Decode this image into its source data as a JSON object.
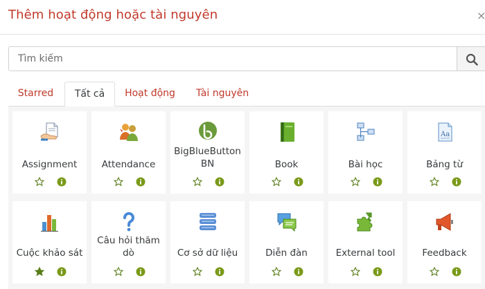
{
  "dialog": {
    "title": "Thêm hoạt động hoặc tài nguyên",
    "close_symbol": "×"
  },
  "search": {
    "placeholder": "Tìm kiếm"
  },
  "tabs": [
    {
      "label": "Starred",
      "active": false
    },
    {
      "label": "Tất cả",
      "active": true
    },
    {
      "label": "Hoạt động",
      "active": false
    },
    {
      "label": "Tài nguyên",
      "active": false
    }
  ],
  "modules": [
    {
      "label": "Assignment",
      "icon": "assignment-icon",
      "starred": false
    },
    {
      "label": "Attendance",
      "icon": "attendance-icon",
      "starred": false
    },
    {
      "label": "BigBlueButton BN",
      "icon": "bigbluebutton-icon",
      "starred": false
    },
    {
      "label": "Book",
      "icon": "book-icon",
      "starred": false
    },
    {
      "label": "Bài học",
      "icon": "lesson-icon",
      "starred": false
    },
    {
      "label": "Bảng từ",
      "icon": "glossary-icon",
      "starred": false
    },
    {
      "label": "Cuộc khảo sát",
      "icon": "survey-icon",
      "starred": true
    },
    {
      "label": "Câu hỏi thăm dò",
      "icon": "choice-icon",
      "starred": false
    },
    {
      "label": "Cơ sở dữ liệu",
      "icon": "database-icon",
      "starred": false
    },
    {
      "label": "Diễn đàn",
      "icon": "forum-icon",
      "starred": false
    },
    {
      "label": "External tool",
      "icon": "external-tool-icon",
      "starred": false
    },
    {
      "label": "Feedback",
      "icon": "feedback-icon",
      "starred": false
    }
  ],
  "colors": {
    "accent": "#c0392b",
    "info_green": "#7a9a1a",
    "star_green": "#5a7d1a"
  }
}
